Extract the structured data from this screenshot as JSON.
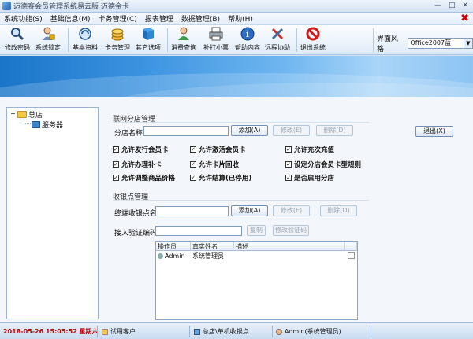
{
  "window": {
    "title": "迈德赛会员管理系统易云版 迈德金卡",
    "minimize": "—",
    "maximize": "□",
    "close": "✕"
  },
  "menu": {
    "items": [
      "系统功能(S)",
      "基础信息(M)",
      "卡务管理(C)",
      "报表管理",
      "数据管理(B)",
      "帮助(H)"
    ],
    "close_glyph": "✖"
  },
  "toolbar": {
    "buttons": [
      {
        "label": "修改密码",
        "icon": "magnifier-icon"
      },
      {
        "label": "系统锁定",
        "icon": "user-lock-icon"
      },
      {
        "label": "基本资料",
        "icon": "globe-icon"
      },
      {
        "label": "卡务管理",
        "icon": "coins-icon"
      },
      {
        "label": "其它选项",
        "icon": "book-icon"
      },
      {
        "label": "消费查询",
        "icon": "person-icon"
      },
      {
        "label": "补打小票",
        "icon": "printer-icon"
      },
      {
        "label": "帮助内容",
        "icon": "info-icon"
      },
      {
        "label": "远程协助",
        "icon": "tools-icon"
      },
      {
        "label": "退出系统",
        "icon": "exit-icon"
      }
    ],
    "style_label": "界面风格",
    "style_value": "Office2007蓝"
  },
  "colors": {
    "accent": "#1a74c8",
    "close": "#c80000"
  },
  "tree": {
    "root": "总店",
    "child": "服务器",
    "expander": "−"
  },
  "branch": {
    "group_title": "联网分店管理",
    "name_label": "分店名称:",
    "name_value": "",
    "add": "添加(A)",
    "modify": "修改(E)",
    "delete": "删除(D)",
    "exit": "退出(X)",
    "options": [
      {
        "label": "允许发行会员卡",
        "checked": true
      },
      {
        "label": "允许激活会员卡",
        "checked": true
      },
      {
        "label": "允许充次充值",
        "checked": true
      },
      {
        "label": "允许办理补卡",
        "checked": true
      },
      {
        "label": "允许卡片回收",
        "checked": true
      },
      {
        "label": "设定分店会员卡型规则",
        "checked": true
      },
      {
        "label": "允许调整商品价格",
        "checked": true
      },
      {
        "label": "允许结算(已停用)",
        "checked": true
      },
      {
        "label": "是否启用分店",
        "checked": true
      }
    ]
  },
  "cashier": {
    "group_title": "收银点管理",
    "terminal_label": "终端收银点名:",
    "terminal_value": "",
    "code_label": "接入验证编码:",
    "code_value": "",
    "add": "添加(A)",
    "modify": "修改(E)",
    "delete": "删除(D)",
    "copy": "复制",
    "modify_code": "修改验证码",
    "table": {
      "headers": [
        "操作员",
        "真实姓名",
        "描述",
        ""
      ],
      "rows": [
        [
          "Admin",
          "系统管理员",
          "",
          ""
        ]
      ]
    }
  },
  "status": {
    "datetime": "2018-05-26 15:05:52 星期六",
    "customer": "试用客户",
    "store": "总店\\单机收银点",
    "user": "Admin(系统管理员)"
  }
}
